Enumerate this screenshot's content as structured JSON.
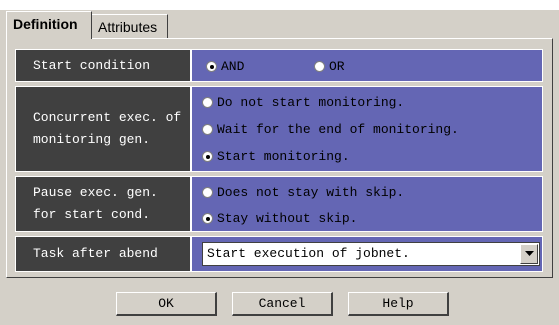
{
  "tabs": [
    {
      "label": "Definition",
      "active": true
    },
    {
      "label": "Attributes",
      "active": false
    }
  ],
  "start_condition": {
    "label": "Start condition",
    "options": [
      {
        "label": "AND",
        "selected": true
      },
      {
        "label": "OR",
        "selected": false
      }
    ]
  },
  "concurrent_exec": {
    "label_line1": "Concurrent exec. of",
    "label_line2": "monitoring gen.",
    "options": [
      {
        "label": "Do not start monitoring.",
        "selected": false
      },
      {
        "label": "Wait for the end of monitoring.",
        "selected": false
      },
      {
        "label": "Start monitoring.",
        "selected": true
      }
    ]
  },
  "pause_exec": {
    "label_line1": "Pause exec. gen.",
    "label_line2": "for start cond.",
    "options": [
      {
        "label": "Does not stay with skip.",
        "selected": false
      },
      {
        "label": "Stay without skip.",
        "selected": true
      }
    ]
  },
  "task_after_abend": {
    "label": "Task after abend",
    "selected_value": "Start execution of jobnet.",
    "icon": "chevron-down-icon"
  },
  "buttons": {
    "ok": "OK",
    "cancel": "Cancel",
    "help": "Help"
  },
  "colors": {
    "dialog_bg": "#d4d0c8",
    "label_bg": "#404040",
    "value_bg": "#6466b4"
  }
}
